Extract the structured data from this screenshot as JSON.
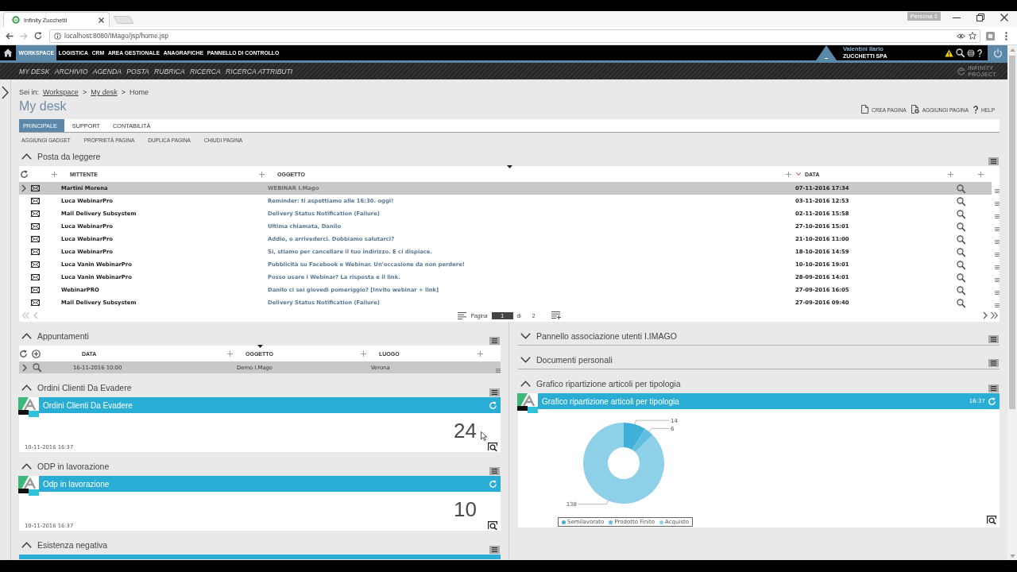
{
  "browser": {
    "tab_title": "Infinity Zucchetti",
    "profile": "Persona 1",
    "url": "localhost:8080/IMago/jsp/home.jsp"
  },
  "top_nav": {
    "items": [
      {
        "label": "WORKSPACE",
        "selected": true
      },
      {
        "label": "LOGISTICA",
        "selected": false
      },
      {
        "label": "CRM",
        "selected": false
      },
      {
        "label": "AREA GESTIONALE",
        "selected": false
      },
      {
        "label": "ANAGRAFICHE",
        "selected": false
      },
      {
        "label": "PANNELLO DI CONTROLLO",
        "selected": false
      }
    ],
    "user": {
      "name": "Valentini Ilario",
      "company": "ZUCCHETTI SPA"
    }
  },
  "sub_nav": {
    "items": [
      "MY DESK",
      "ARCHIVIO",
      "AGENDA",
      "POSTA",
      "RUBRICA",
      "RICERCA",
      "RICERCA ATTRIBUTI"
    ],
    "logo": [
      "INFINITY",
      "PROJECT"
    ]
  },
  "breadcrumb": {
    "label": "Sei in:",
    "items": [
      {
        "text": "Workspace",
        "kind": "link"
      },
      {
        "text": ">",
        "kind": "separator"
      },
      {
        "text": "My desk",
        "kind": "link"
      },
      {
        "text": ">",
        "kind": "separator"
      },
      {
        "text": "Home",
        "kind": "current"
      }
    ]
  },
  "page": {
    "title": "My desk",
    "actions": [
      {
        "label": "CREA PAGINA",
        "kind": "new"
      },
      {
        "label": "AGGIUNGI PAGINA",
        "kind": "add"
      },
      {
        "label": "HELP",
        "kind": "help"
      }
    ]
  },
  "tabs": [
    {
      "label": "PRINCIPALE",
      "selected": true
    },
    {
      "label": "SUPPORT",
      "selected": false
    },
    {
      "label": "CONTABILITÀ",
      "selected": false
    }
  ],
  "page_actions": [
    "AGGIUNGI GADGET",
    "PROPRIETÀ PAGINA",
    "DUPLICA PAGINA",
    "CHIUDI PAGINA"
  ],
  "mail_panel": {
    "title": "Posta da leggere",
    "expanded": true,
    "columns": [
      {
        "label": "MITTENTE",
        "sorted": false
      },
      {
        "label": "OGGETTO",
        "sorted": false
      },
      {
        "label": "DATA",
        "sorted": true
      }
    ],
    "rows": [
      {
        "sender": "Martini Morena",
        "subject": "WEBINAR I.Mago",
        "date": "07-11-2016 17:34",
        "selected": true
      },
      {
        "sender": "Luca WebinarPro",
        "subject": "Reminder: ti aspettiamo alle 16:30. oggi!",
        "date": "03-11-2016 12:53",
        "selected": false
      },
      {
        "sender": "Mail Delivery Subsystem",
        "subject": "Delivery Status Notification (Failure)",
        "date": "02-11-2016 15:58",
        "selected": false
      },
      {
        "sender": "Luca WebinarPro",
        "subject": "Ultima chiamata, Danilo",
        "date": "27-10-2016 15:01",
        "selected": false
      },
      {
        "sender": "Luca WebinarPro",
        "subject": "Addio, o arrivederci. Dobbiamo salutarci?",
        "date": "21-10-2016 11:00",
        "selected": false
      },
      {
        "sender": "Luca WebinarPro",
        "subject": "Si, stiamo per cancellare il tuo indirizzo. E ci dispiace.",
        "date": "18-10-2016 14:59",
        "selected": false
      },
      {
        "sender": "Luca Vanin WebinarPro",
        "subject": "Pubblicità su Facebook e Webinar. Un'occasione da non perdere!",
        "date": "10-10-2016 19:01",
        "selected": false
      },
      {
        "sender": "Luca Vanin WebinarPro",
        "subject": "Posso usare i Webinar? La risposta e il link.",
        "date": "28-09-2016 14:01",
        "selected": false
      },
      {
        "sender": "WebinarPRO",
        "subject": "Danilo ci sei giovedì pomeriggio? [Invito webinar + link]",
        "date": "27-09-2016 16:05",
        "selected": false
      },
      {
        "sender": "Mail Delivery Subsystem",
        "subject": "Delivery Status Notification (Failure)",
        "date": "27-09-2016 09:40",
        "selected": false
      }
    ],
    "pagination": {
      "label": "Pagina",
      "page": "1",
      "separator": "di",
      "total": "2",
      "previous_disabled": true,
      "next_disabled": false
    }
  },
  "left_panels": [
    {
      "title": "Appuntamenti",
      "expanded": true,
      "kind": "table",
      "columns": [
        "DATA",
        "OGGETTO",
        "LUOGO"
      ],
      "rows": [
        {
          "date": "16-11-2016 10:00",
          "subject": "Demo I.Mago",
          "place": "Verona",
          "selected": true
        }
      ]
    },
    {
      "title": "Ordini Clienti Da Evadere",
      "expanded": true,
      "kind": "counter",
      "widget_title": "Ordini Clienti Da Evadere",
      "value": "24",
      "timestamp": "10-11-2016 16:37"
    },
    {
      "title": "ODP in lavorazione",
      "expanded": true,
      "kind": "counter",
      "widget_title": "Odp in lavorazione",
      "value": "10",
      "timestamp": "10-11-2016 16:37"
    },
    {
      "title": "Esistenza negativa",
      "expanded": true,
      "kind": "counter"
    }
  ],
  "right_panels": [
    {
      "title": "Pannello associazione utenti I.IMAGO",
      "expanded": false
    },
    {
      "title": "Documenti personali",
      "expanded": false
    },
    {
      "title": "Grafico ripartizione articoli per tipologia",
      "expanded": true,
      "kind": "chart",
      "widget_title": "Grafico ripartizione articoli per tipologia",
      "time": "16:37",
      "chart_data": {
        "type": "donut",
        "categories": [
          "Semilavorato",
          "Prodotto Finito",
          "Acquisto"
        ],
        "values": [
          14,
          6,
          138
        ],
        "colors": [
          "#3fb0d8",
          "#62bfe1",
          "#8dd0e7"
        ],
        "data_labels": true,
        "legend": "bottom"
      }
    }
  ]
}
